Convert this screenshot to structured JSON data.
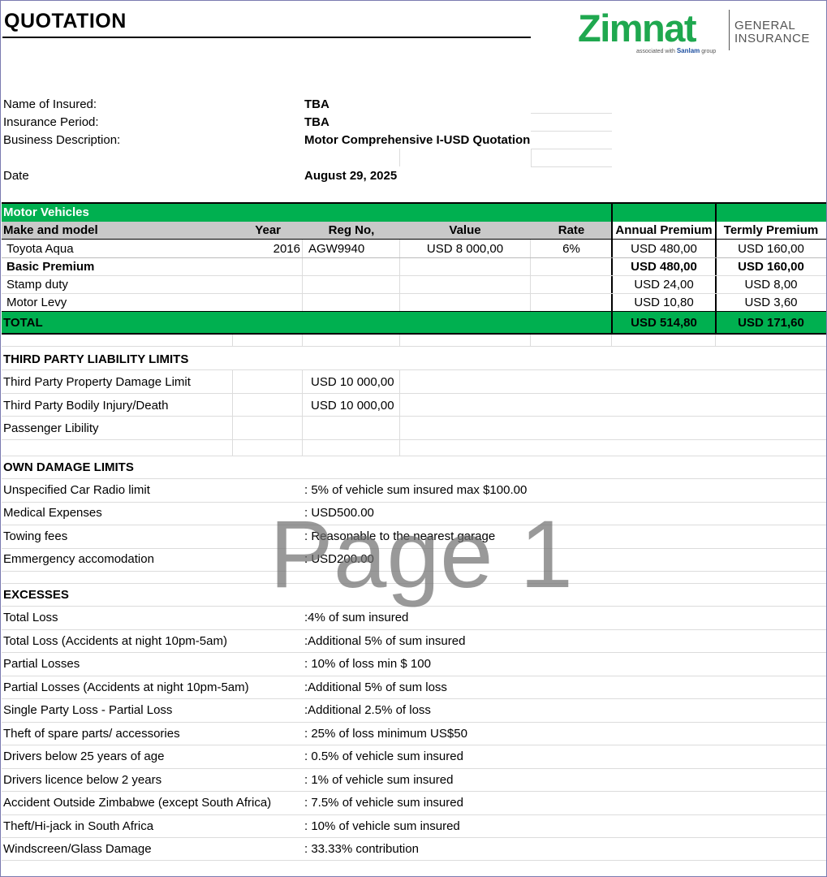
{
  "title": "QUOTATION",
  "logo": {
    "brand": "Zimnat",
    "line1": "GENERAL",
    "line2": "INSURANCE",
    "assoc": "associated with",
    "partner": "Sanlam",
    "partner_suffix": "group"
  },
  "details": [
    {
      "label": "Name of Insured:",
      "value": "TBA"
    },
    {
      "label": "Insurance Period:",
      "value": "TBA"
    },
    {
      "label": "Business Description:",
      "value": "Motor Comprehensive I-USD Quotation"
    },
    {
      "label": "Date",
      "value": "August 29, 2025"
    }
  ],
  "vehicles": {
    "section": "Motor Vehicles",
    "headers": {
      "make": "Make and model",
      "year": "Year",
      "reg": "Reg No,",
      "value": "Value",
      "rate": "Rate",
      "annual": "Annual Premium",
      "termly": "Termly Premium"
    },
    "row": {
      "make": "Toyota Aqua",
      "year": "2016",
      "reg": "AGW9940",
      "value": "USD 8 000,00",
      "rate": "6%",
      "annual": "USD 480,00",
      "termly": "USD 160,00"
    },
    "basic": {
      "label": "Basic Premium",
      "annual": "USD 480,00",
      "termly": "USD 160,00"
    },
    "stamp": {
      "label": "Stamp duty",
      "annual": "USD 24,00",
      "termly": "USD 8,00"
    },
    "levy": {
      "label": "Motor Levy",
      "annual": "USD 10,80",
      "termly": "USD 3,60"
    },
    "total": {
      "label": "TOTAL",
      "annual": "USD 514,80",
      "termly": "USD 171,60"
    }
  },
  "third_party": {
    "heading": "THIRD PARTY LIABILITY LIMITS",
    "items": [
      {
        "label": "Third Party Property Damage Limit",
        "value": "USD 10 000,00"
      },
      {
        "label": "Third Party Bodily Injury/Death",
        "value": "USD 10 000,00"
      },
      {
        "label": "Passenger Libility",
        "value": ""
      }
    ]
  },
  "own_damage": {
    "heading": "OWN DAMAGE LIMITS",
    "items": [
      {
        "label": "Unspecified Car Radio limit",
        "value": ": 5% of vehicle sum insured max $100.00"
      },
      {
        "label": "Medical Expenses",
        "value": ": USD500.00"
      },
      {
        "label": "Towing fees",
        "value": ": Reasonable to the nearest garage"
      },
      {
        "label": "Emmergency accomodation",
        "value": ": USD200.00"
      }
    ]
  },
  "excesses": {
    "heading": "EXCESSES",
    "items": [
      {
        "label": "Total Loss",
        "value": ":4% of sum insured"
      },
      {
        "label": "Total Loss (Accidents at night 10pm-5am)",
        "value": ":Additional 5% of sum insured"
      },
      {
        "label": "Partial Losses",
        "value": ": 10% of loss min $ 100"
      },
      {
        "label": "Partial Losses (Accidents at night  10pm-5am)",
        "value": ":Additional 5% of sum loss"
      },
      {
        "label": "Single Party Loss - Partial Loss",
        "value": ":Additional 2.5% of loss"
      },
      {
        "label": "Theft of spare parts/ accessories",
        "value": ": 25% of loss minimum US$50"
      },
      {
        "label": "Drivers below 25 years of age",
        "value": ": 0.5% of vehicle sum insured"
      },
      {
        "label": "Drivers licence below 2 years",
        "value": ": 1% of vehicle sum insured"
      },
      {
        "label": "Accident Outside Zimbabwe (except South Africa)",
        "value": ": 7.5% of vehicle sum insured"
      },
      {
        "label": "Theft/Hi-jack in South Africa",
        "value": ": 10% of vehicle sum insured"
      },
      {
        "label": "Windscreen/Glass Damage",
        "value": ": 33.33% contribution"
      }
    ]
  },
  "watermark": "Page 1",
  "colors": {
    "accent_green": "#00b050",
    "header_gray": "#c9c9c9",
    "brand_green": "#1fa84f"
  }
}
